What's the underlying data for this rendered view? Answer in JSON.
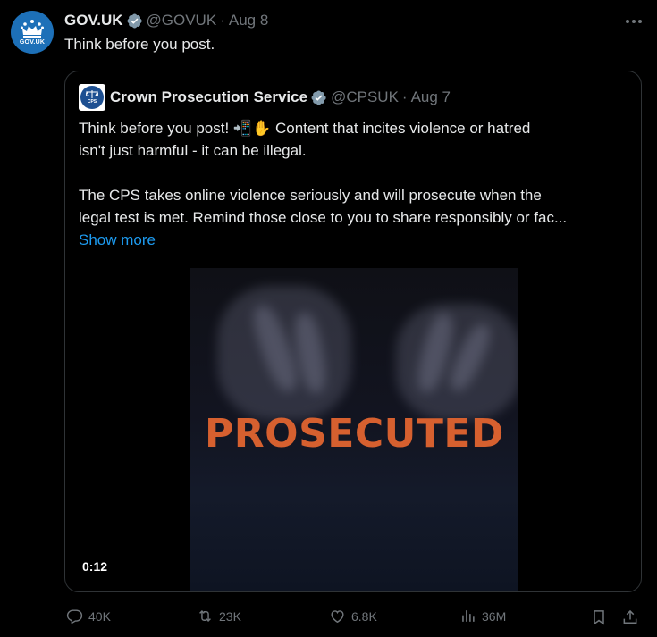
{
  "tweet": {
    "author_name": "GOV.UK",
    "author_handle": "@GOVUK",
    "separator": "·",
    "date": "Aug 8",
    "avatar_text": "GOV.UK",
    "text": "Think before you post.",
    "more_icon": "more-horizontal-icon"
  },
  "quote": {
    "author_name": "Crown Prosecution Service",
    "author_handle": "@CPSUK",
    "separator": "·",
    "date": "Aug 7",
    "avatar_text": "CPS",
    "lines": [
      "Think before you post! 📲✋ Content that incites violence or hatred",
      "isn't just harmful - it can be illegal.",
      "The CPS takes online violence seriously and will prosecute when the",
      "legal test is met. Remind those close to you to share responsibly or fac..."
    ],
    "show_more": "Show more",
    "video": {
      "overlay_text": "PROSECUTED",
      "duration": "0:12"
    }
  },
  "actions": {
    "replies": "40K",
    "reposts": "23K",
    "likes": "6.8K",
    "views": "36M"
  },
  "colors": {
    "background": "#000000",
    "text": "#e7e9ea",
    "muted": "#71767b",
    "link": "#1d9bf0",
    "verified": "#829aab",
    "govuk_blue": "#1d70b8",
    "prosecuted_orange": "#d6602f"
  }
}
